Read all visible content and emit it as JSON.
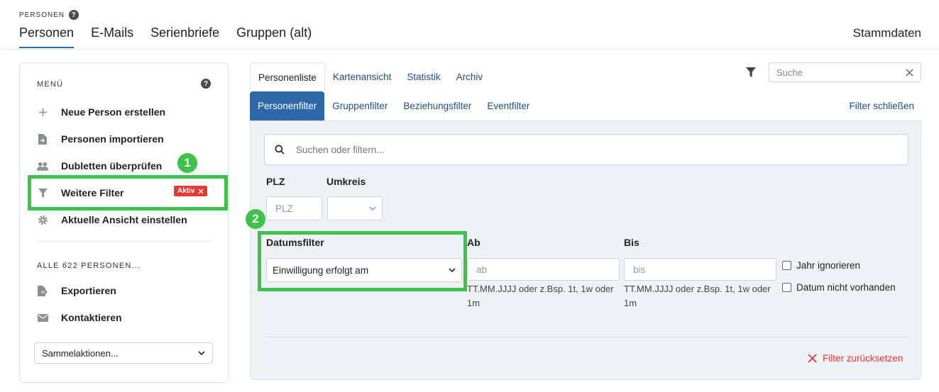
{
  "header": {
    "breadcrumb": "PERSONEN",
    "help_glyph": "?",
    "tabs": [
      {
        "label": "Personen",
        "active": true
      },
      {
        "label": "E-Mails",
        "active": false
      },
      {
        "label": "Serienbriefe",
        "active": false
      },
      {
        "label": "Gruppen (alt)",
        "active": false
      }
    ],
    "stammdaten": "Stammdaten"
  },
  "sidebar": {
    "menu_title": "MENÜ",
    "items": [
      {
        "label": "Neue Person erstellen",
        "icon": "plus-icon"
      },
      {
        "label": "Personen importieren",
        "icon": "file-import-icon"
      },
      {
        "label": "Dubletten überprüfen",
        "icon": "users-icon"
      },
      {
        "label": "Weitere Filter",
        "icon": "filter-icon"
      },
      {
        "label": "Aktuelle Ansicht einstellen",
        "icon": "gear-icon"
      }
    ],
    "active_badge": "Aktiv",
    "section_title": "ALLE 622 PERSONEN...",
    "section_items": [
      {
        "label": "Exportieren",
        "icon": "file-export-icon"
      },
      {
        "label": "Kontaktieren",
        "icon": "envelope-icon"
      }
    ],
    "bulk_select": "Sammelaktionen..."
  },
  "markers": [
    "1",
    "2"
  ],
  "view_tabs": [
    {
      "label": "Personenliste",
      "active": true
    },
    {
      "label": "Kartenansicht",
      "active": false
    },
    {
      "label": "Statistik",
      "active": false
    },
    {
      "label": "Archiv",
      "active": false
    }
  ],
  "top_search": {
    "placeholder": "Suche"
  },
  "filter_tabs": [
    {
      "label": "Personenfilter",
      "active": true
    },
    {
      "label": "Gruppenfilter",
      "active": false
    },
    {
      "label": "Beziehungsfilter",
      "active": false
    },
    {
      "label": "Eventfilter",
      "active": false
    }
  ],
  "filter_close": "Filter schließen",
  "filter_panel": {
    "search_placeholder": "Suchen oder filtern...",
    "plz_label": "PLZ",
    "plz_placeholder": "PLZ",
    "umkreis_label": "Umkreis",
    "datumsfilter_label": "Datumsfilter",
    "datumsfilter_value": "Einwilligung erfolgt am",
    "ab_label": "Ab",
    "ab_placeholder": "ab",
    "ab_hint": "TT.MM.JJJJ oder z.Bsp. 1t, 1w oder 1m",
    "bis_label": "Bis",
    "bis_placeholder": "bis",
    "bis_hint": "TT.MM.JJJJ oder z.Bsp. 1t, 1w oder 1m",
    "checkbox_year": "Jahr ignorieren",
    "checkbox_missing": "Datum nicht vorhanden",
    "reset": "Filter zurücksetzen"
  },
  "colors": {
    "accent": "#2f68a8",
    "highlight": "#3ec24a",
    "danger": "#e53935",
    "panel": "#eef1f6"
  }
}
